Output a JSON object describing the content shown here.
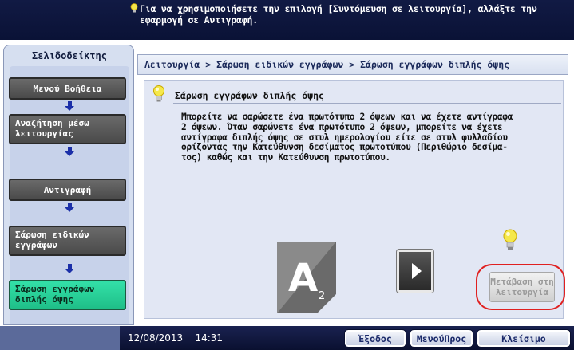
{
  "top_message": {
    "line1": "Για να χρησιμοποιήσετε την επιλογή [Συντόμευση σε λειτουργία], αλλάξτε την",
    "line2": "εφαρμογή σε Αντιγραφή."
  },
  "bookmark_panel": {
    "title": "Σελιδοδείκτης",
    "items": [
      {
        "label_lines": [
          "Μενού Βοήθεια"
        ]
      },
      {
        "label_lines": [
          "Αναζήτηση μέσω",
          "λειτουργίας"
        ]
      },
      {
        "label_lines": [
          "Αντιγραφή"
        ]
      },
      {
        "label_lines": [
          "Σάρωση ειδικών",
          "εγγράφων"
        ]
      },
      {
        "label_lines": [
          "Σάρωση εγγράφων",
          "διπλής όψης"
        ],
        "active": true
      }
    ]
  },
  "breadcrumb": {
    "part1": "Λειτουργία",
    "sep1": ">",
    "part2": "Σάρωση ειδικών εγγράφων",
    "sep2": ">",
    "part3": "Σάρωση εγγράφων διπλής όψης"
  },
  "help": {
    "title": "Σάρωση εγγράφων διπλής όψης",
    "text_lines": [
      "Μπορείτε να σαρώσετε ένα πρωτότυπο 2 όψεων και να έχετε αντίγραφα",
      "2 όψεων. Όταν σαρώνετε ένα πρωτότυπο 2 όψεων, μπορείτε να έχετε",
      "αντίγραφα διπλής όψης σε στυλ ημερολογίου είτε σε στυλ φυλλαδίου",
      "ορίζοντας την Κατεύθυνση δεσίματος πρωτοτύπου (Περιθώριο δεσίμα-",
      "τος) καθώς και την Κατεύθυνση πρωτοτύπου."
    ],
    "demo_letter": "A",
    "demo_sub": "2",
    "goto_lines": [
      "Μετάβαση στη",
      "λειτουργία"
    ]
  },
  "status": {
    "date": "12/08/2013",
    "time": "14:31"
  },
  "bottom_buttons": {
    "exit": "Έξοδος",
    "menu": "ΜενούΠρος",
    "close": "Κλείσιμο"
  },
  "colors": {
    "active_nav": "#1fbf88",
    "highlight_ring": "#e02020",
    "arrow": "#1b2fa8"
  }
}
